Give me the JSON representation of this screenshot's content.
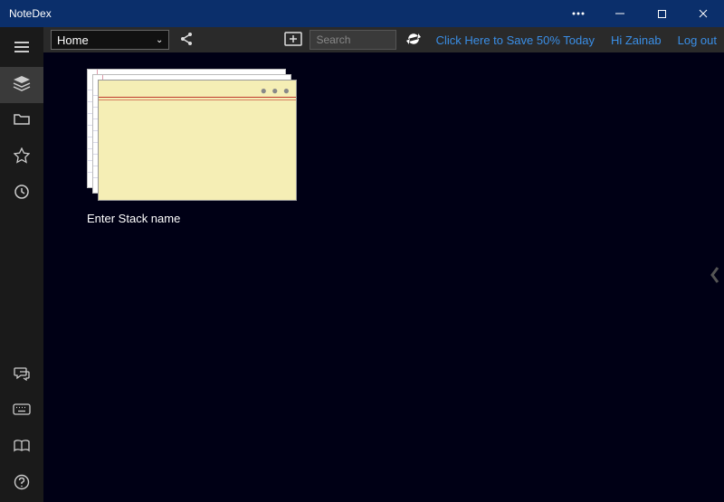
{
  "titlebar": {
    "app_name": "NoteDex"
  },
  "toolbar": {
    "location_label": "Home",
    "search_placeholder": "Search",
    "promo_link": "Click Here to Save 50% Today",
    "greeting": "Hi Zainab",
    "logout": "Log out"
  },
  "stack": {
    "placeholder_label": "Enter Stack name"
  },
  "colors": {
    "titlebar_bg": "#0b2f6b",
    "link": "#3a8ee6",
    "card_front": "#f5eeb5"
  }
}
